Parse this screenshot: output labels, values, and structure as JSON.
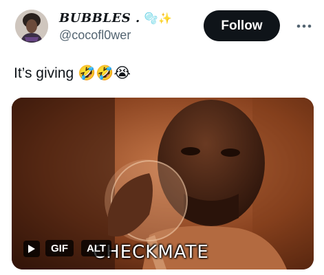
{
  "user": {
    "display_name": "BUBBLES .",
    "name_emojis": "🫧✨",
    "handle": "@cocofl0wer",
    "avatar_icon": "avatar-photo"
  },
  "actions": {
    "follow_label": "Follow",
    "more_icon": "more-horizontal-icon"
  },
  "tweet": {
    "text": "It’s giving",
    "emojis": "🤣🤣😭"
  },
  "media": {
    "play_icon": "play-icon",
    "gif_label": "GIF",
    "alt_label": "ALT",
    "caption": "CHECKMATE"
  }
}
